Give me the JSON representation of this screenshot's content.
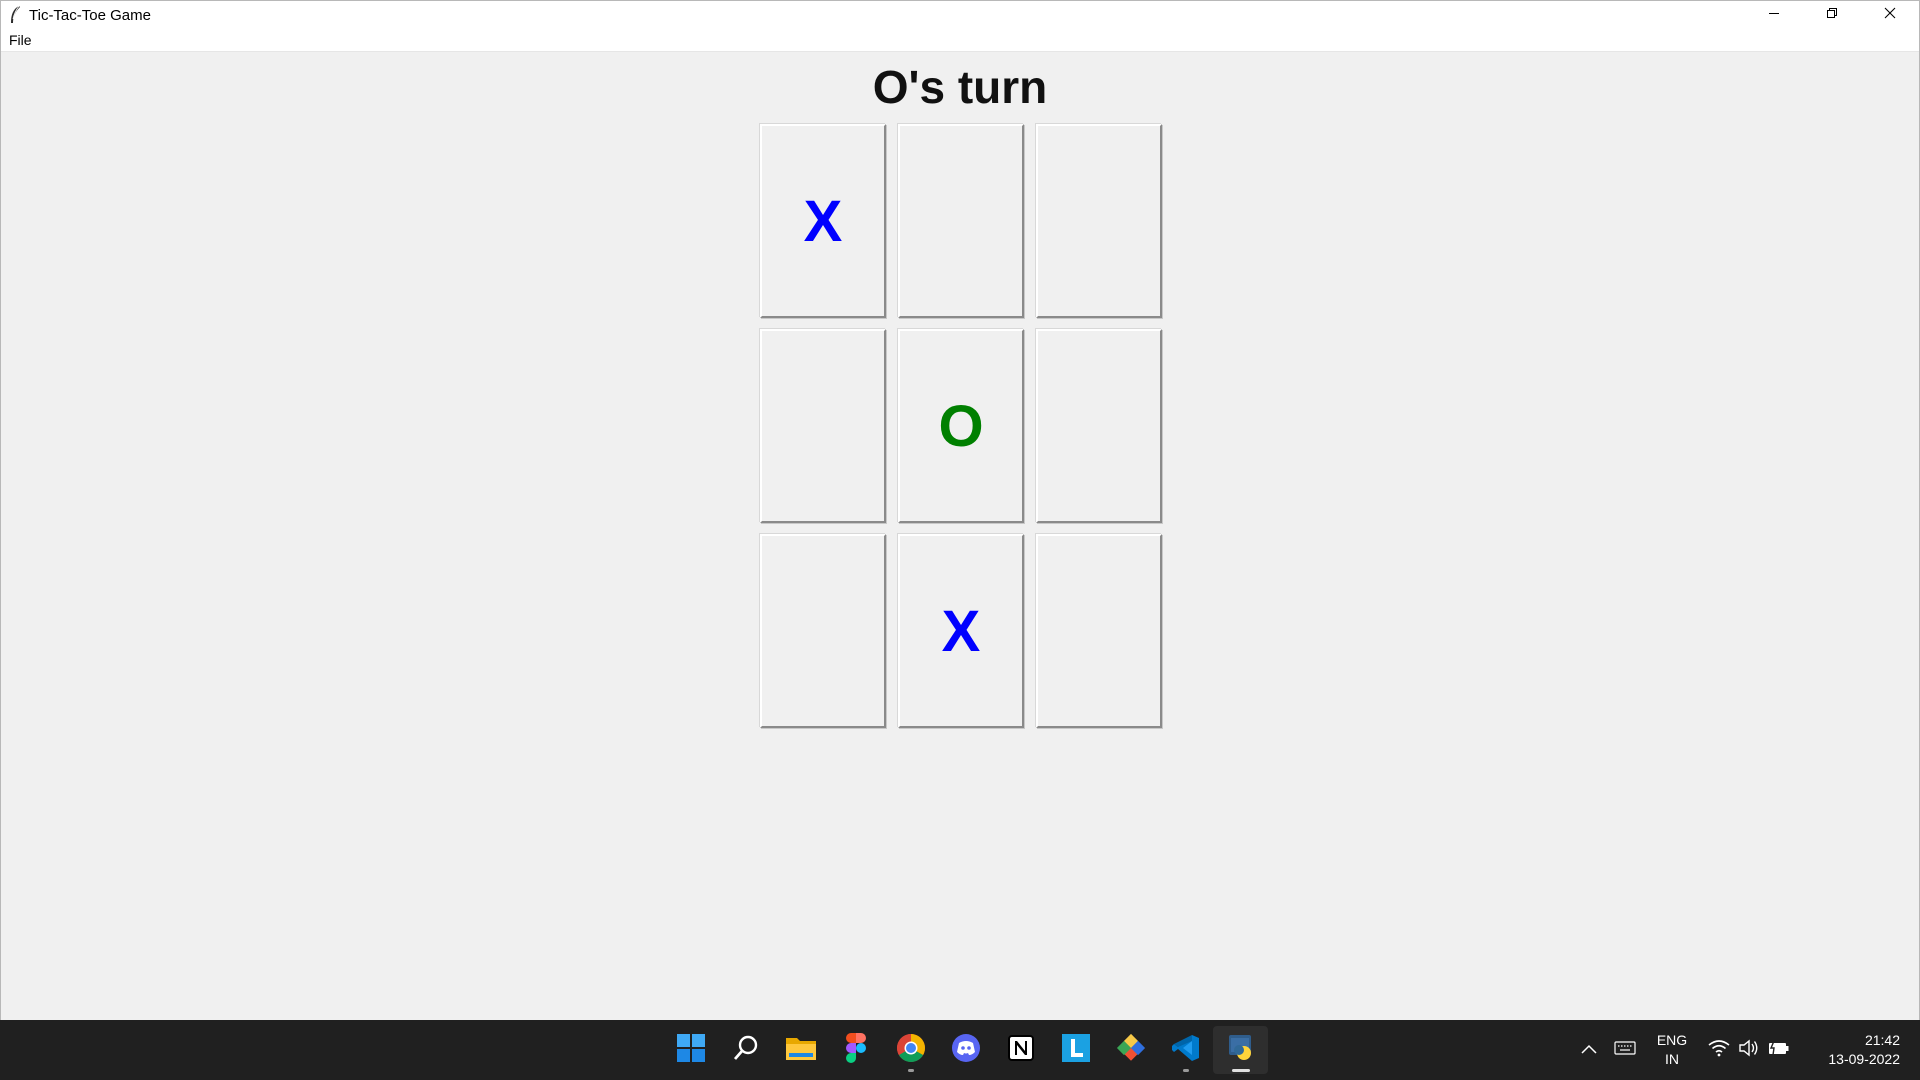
{
  "window": {
    "title": "Tic-Tac-Toe Game",
    "controls": [
      "minimize-icon",
      "restore-icon",
      "close-icon"
    ]
  },
  "menu": {
    "items": [
      {
        "label": "File"
      }
    ]
  },
  "game": {
    "status": "O's turn",
    "board": [
      [
        "X",
        "",
        ""
      ],
      [
        "",
        "O",
        ""
      ],
      [
        "",
        "X",
        ""
      ]
    ],
    "colors": {
      "X": "#0000ff",
      "O": "#008000"
    }
  },
  "taskbar": {
    "apps": [
      "windows-start-icon",
      "search-icon",
      "file-explorer-icon",
      "figma-icon",
      "chrome-icon",
      "discord-icon",
      "notion-icon",
      "l-app-icon",
      "git-icon",
      "vscode-icon",
      "python-icon"
    ],
    "tray": {
      "language_line1": "ENG",
      "language_line2": "IN",
      "time": "21:42",
      "date": "13-09-2022"
    }
  }
}
